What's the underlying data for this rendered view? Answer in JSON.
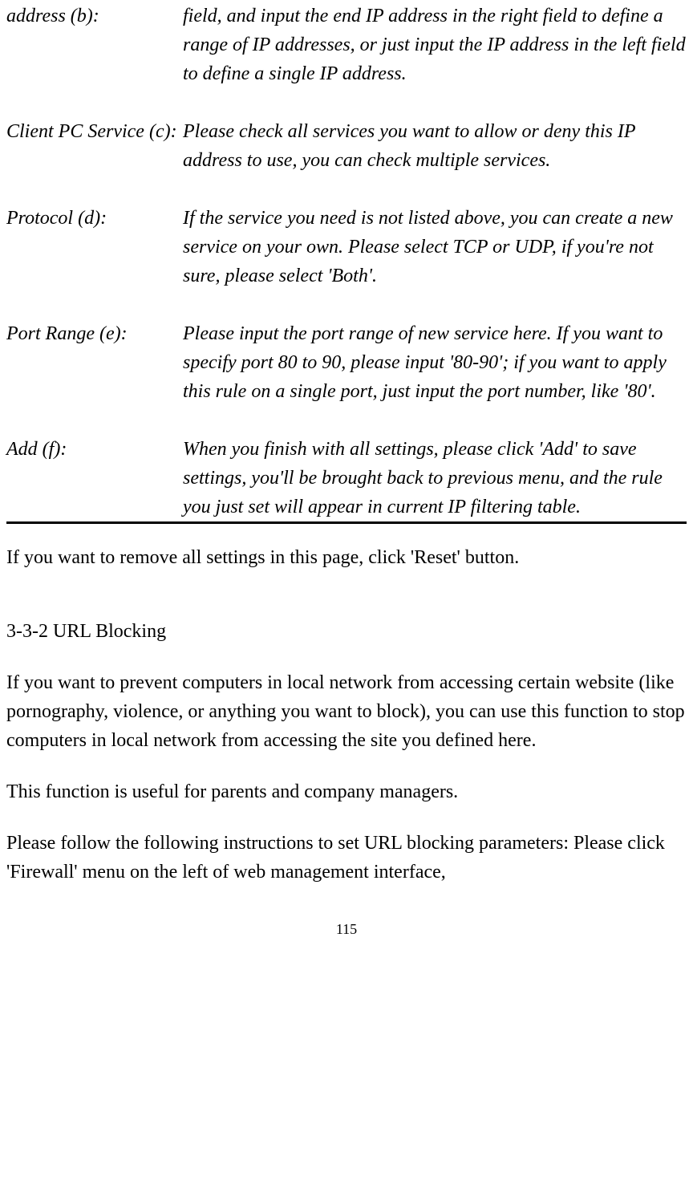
{
  "definitions": [
    {
      "label": "address (b):",
      "desc": "field, and input the end IP address in the right field to define a range of IP addresses, or just input the IP address in the left field to define a single IP address."
    },
    {
      "label": "Client PC Service (c):",
      "desc": "Please check all services you want to allow or deny this IP address to use, you can check multiple services."
    },
    {
      "label": "Protocol (d):",
      "desc": "If the service you need is not listed above, you can create a new service on your own. Please select TCP or UDP, if you're not sure, please select 'Both'."
    },
    {
      "label": "Port Range (e):",
      "desc": "Please input the port range of new service here. If you want to specify port 80 to 90, please input '80-90'; if you want to apply this rule on a single port, just input the port number, like '80'."
    },
    {
      "label": "Add (f):",
      "desc": "When you finish with all settings, please click 'Add' to save settings, you'll be brought back to previous menu, and the rule you just set will appear in current IP filtering table."
    }
  ],
  "para_reset": "If you want to remove all settings in this page, click 'Reset' button.",
  "section_heading": "3-3-2 URL Blocking",
  "para_urlblock": "If you want to prevent computers in local network from accessing certain website (like pornography, violence, or anything you want to block), you can use this function to stop computers in local network from accessing the site you defined here.",
  "para_useful": "This function is useful for parents and company managers.",
  "para_instructions": "Please follow the following instructions to set URL blocking parameters: Please click 'Firewall' menu on the left of web management interface,",
  "page_number": "115"
}
